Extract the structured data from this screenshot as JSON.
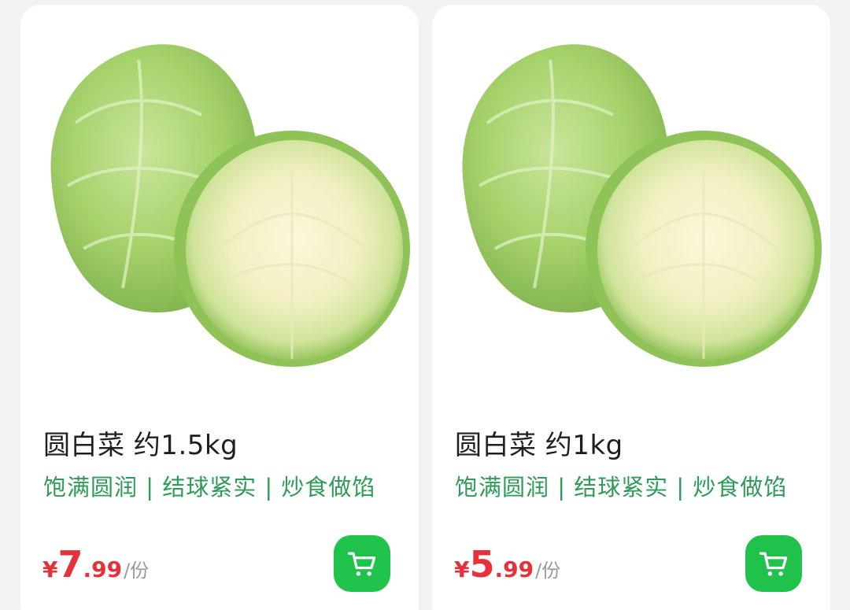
{
  "products": [
    {
      "name": "圆白菜 约1.5kg",
      "tagline": "饱满圆润 | 结球紧实 | 炒食做馅",
      "currency": "¥",
      "price_int": "7",
      "price_dec": ".99",
      "unit": "/份",
      "image": "cabbage-photo",
      "cart_icon": "shopping-cart-icon"
    },
    {
      "name": "圆白菜 约1kg",
      "tagline": "饱满圆润 | 结球紧实 | 炒食做馅",
      "currency": "¥",
      "price_int": "5",
      "price_dec": ".99",
      "unit": "/份",
      "image": "cabbage-photo",
      "cart_icon": "shopping-cart-icon"
    }
  ],
  "colors": {
    "accent_green": "#1fc24a",
    "tagline_green": "#2f9b58",
    "price_red": "#e7303a"
  }
}
